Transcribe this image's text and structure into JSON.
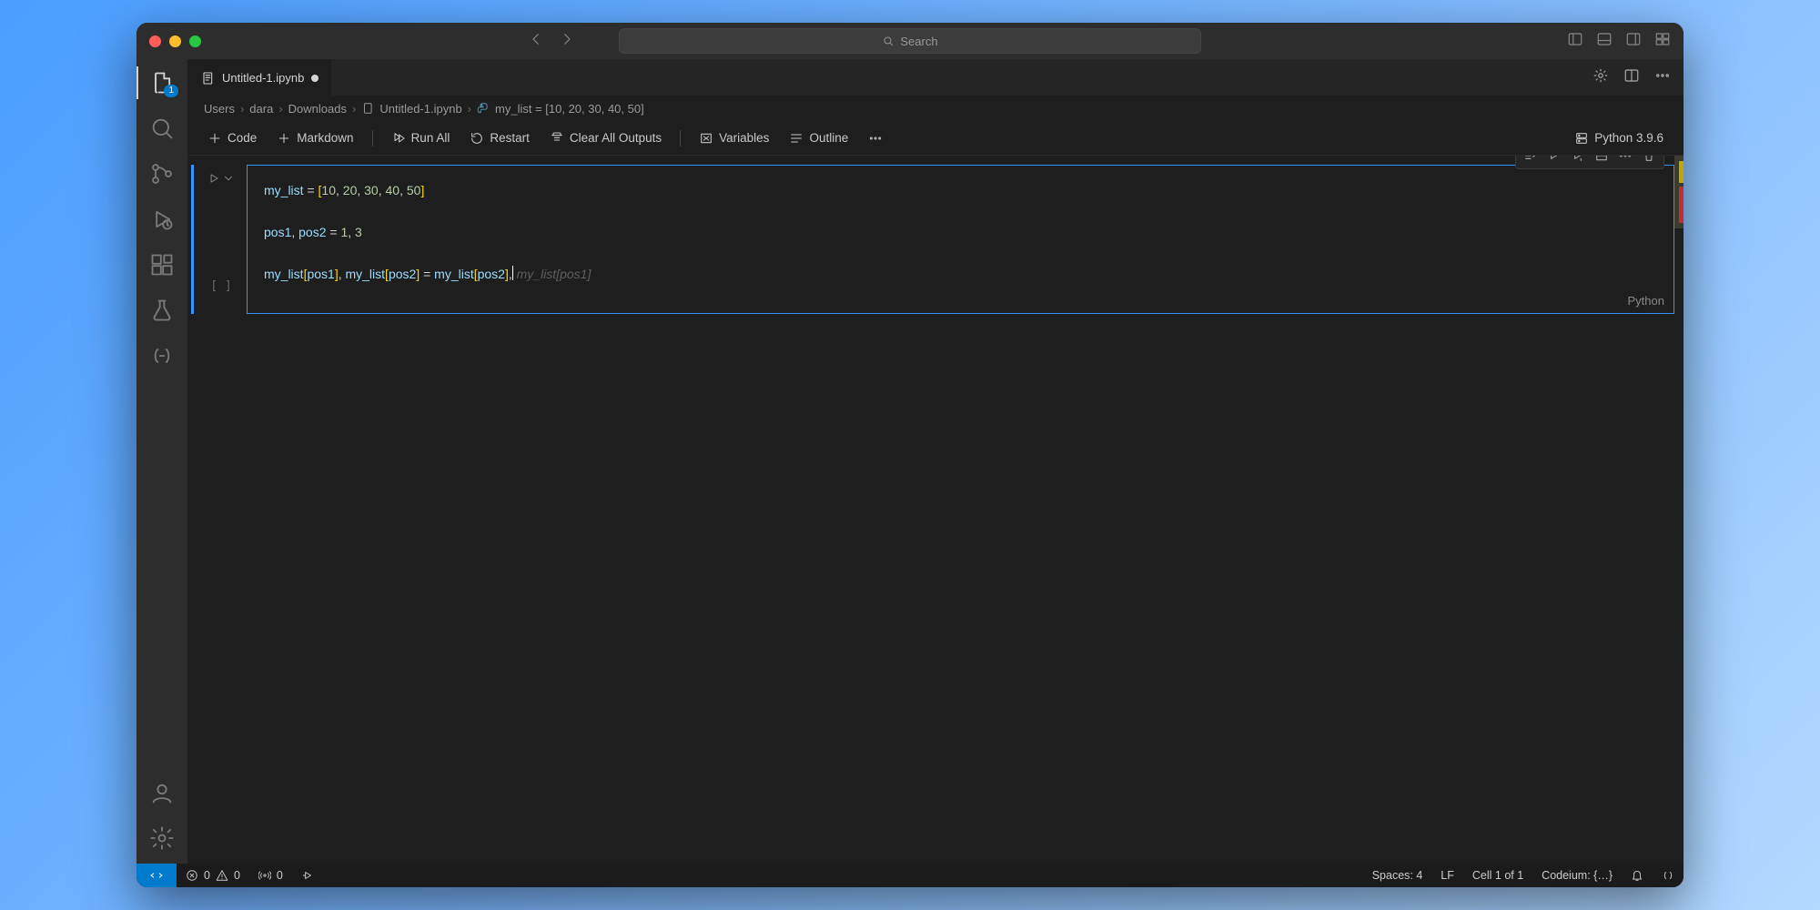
{
  "titlebar": {
    "search_placeholder": "Search"
  },
  "tab": {
    "filename": "Untitled-1.ipynb"
  },
  "breadcrumb": {
    "parts": [
      "Users",
      "dara",
      "Downloads",
      "Untitled-1.ipynb"
    ],
    "symbol": "my_list = [10, 20, 30, 40, 50]"
  },
  "toolbar": {
    "code": "Code",
    "markdown": "Markdown",
    "run_all": "Run All",
    "restart": "Restart",
    "clear_outputs": "Clear All Outputs",
    "variables": "Variables",
    "outline": "Outline",
    "kernel": "Python 3.9.6"
  },
  "cell": {
    "execution_label": "[ ]",
    "language": "Python",
    "code_tokens": [
      [
        [
          "var",
          "my_list"
        ],
        [
          "op",
          " = "
        ],
        [
          "br",
          "["
        ],
        [
          "num",
          "10"
        ],
        [
          "op",
          ", "
        ],
        [
          "num",
          "20"
        ],
        [
          "op",
          ", "
        ],
        [
          "num",
          "30"
        ],
        [
          "op",
          ", "
        ],
        [
          "num",
          "40"
        ],
        [
          "op",
          ", "
        ],
        [
          "num",
          "50"
        ],
        [
          "br",
          "]"
        ]
      ],
      [],
      [
        [
          "var",
          "pos1"
        ],
        [
          "op",
          ", "
        ],
        [
          "var",
          "pos2"
        ],
        [
          "op",
          " = "
        ],
        [
          "num",
          "1"
        ],
        [
          "op",
          ", "
        ],
        [
          "num",
          "3"
        ]
      ],
      [],
      [
        [
          "var",
          "my_list"
        ],
        [
          "br",
          "["
        ],
        [
          "var",
          "pos1"
        ],
        [
          "br",
          "]"
        ],
        [
          "op",
          ", "
        ],
        [
          "var",
          "my_list"
        ],
        [
          "br",
          "["
        ],
        [
          "var",
          "pos2"
        ],
        [
          "br",
          "]"
        ],
        [
          "op",
          " = "
        ],
        [
          "var",
          "my_list"
        ],
        [
          "br",
          "["
        ],
        [
          "var",
          "pos2"
        ],
        [
          "br",
          "]"
        ],
        [
          "op",
          ","
        ],
        [
          "cursor",
          ""
        ],
        [
          "op",
          " "
        ],
        [
          "ghost",
          "my_list[pos1]"
        ]
      ]
    ]
  },
  "activity": {
    "explorer_badge": "1"
  },
  "status": {
    "errors": "0",
    "warnings": "0",
    "ports": "0",
    "spaces": "Spaces: 4",
    "eol": "LF",
    "cell_pos": "Cell 1 of 1",
    "codeium": "Codeium: {…}"
  }
}
